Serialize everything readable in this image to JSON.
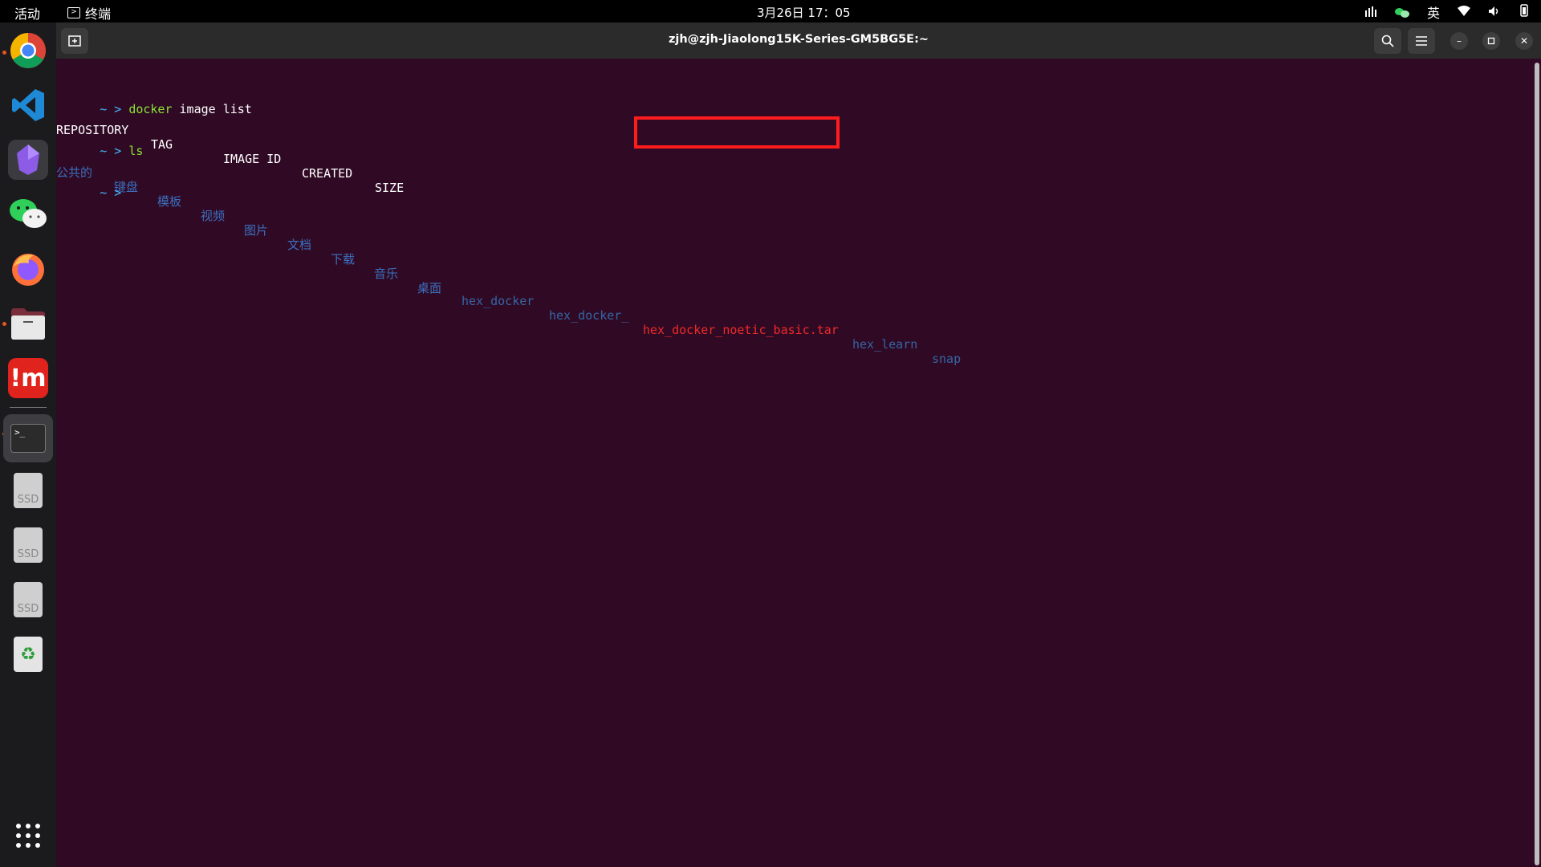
{
  "topbar": {
    "activities": "活动",
    "app_name": "终端",
    "clock": "3月26日  17：05",
    "input_method": "英"
  },
  "dock": {
    "ssd_label": "SSD"
  },
  "window": {
    "title": "zjh@zjh-Jiaolong15K-Series-GM5BG5E:~"
  },
  "terminal": {
    "prompt": "~ >",
    "line1_cmd": "docker",
    "line1_args": " image list",
    "headers": [
      "REPOSITORY",
      "TAG",
      "IMAGE ID",
      "CREATED",
      "SIZE"
    ],
    "line3_cmd": "ls",
    "ls_entries": [
      "公共的",
      "键盘",
      "模板",
      "视频",
      "图片",
      "文档",
      "下载",
      "音乐",
      "桌面",
      "hex_docker",
      "hex_docker_",
      "hex_docker_noetic_basic.tar",
      "hex_learn",
      "snap"
    ]
  },
  "colors": {
    "terminal_bg": "#300a24",
    "prompt": "#45b8ff",
    "directory": "#3465a4",
    "archive": "#ef2929",
    "highlight_box": "#ff1c1c"
  }
}
